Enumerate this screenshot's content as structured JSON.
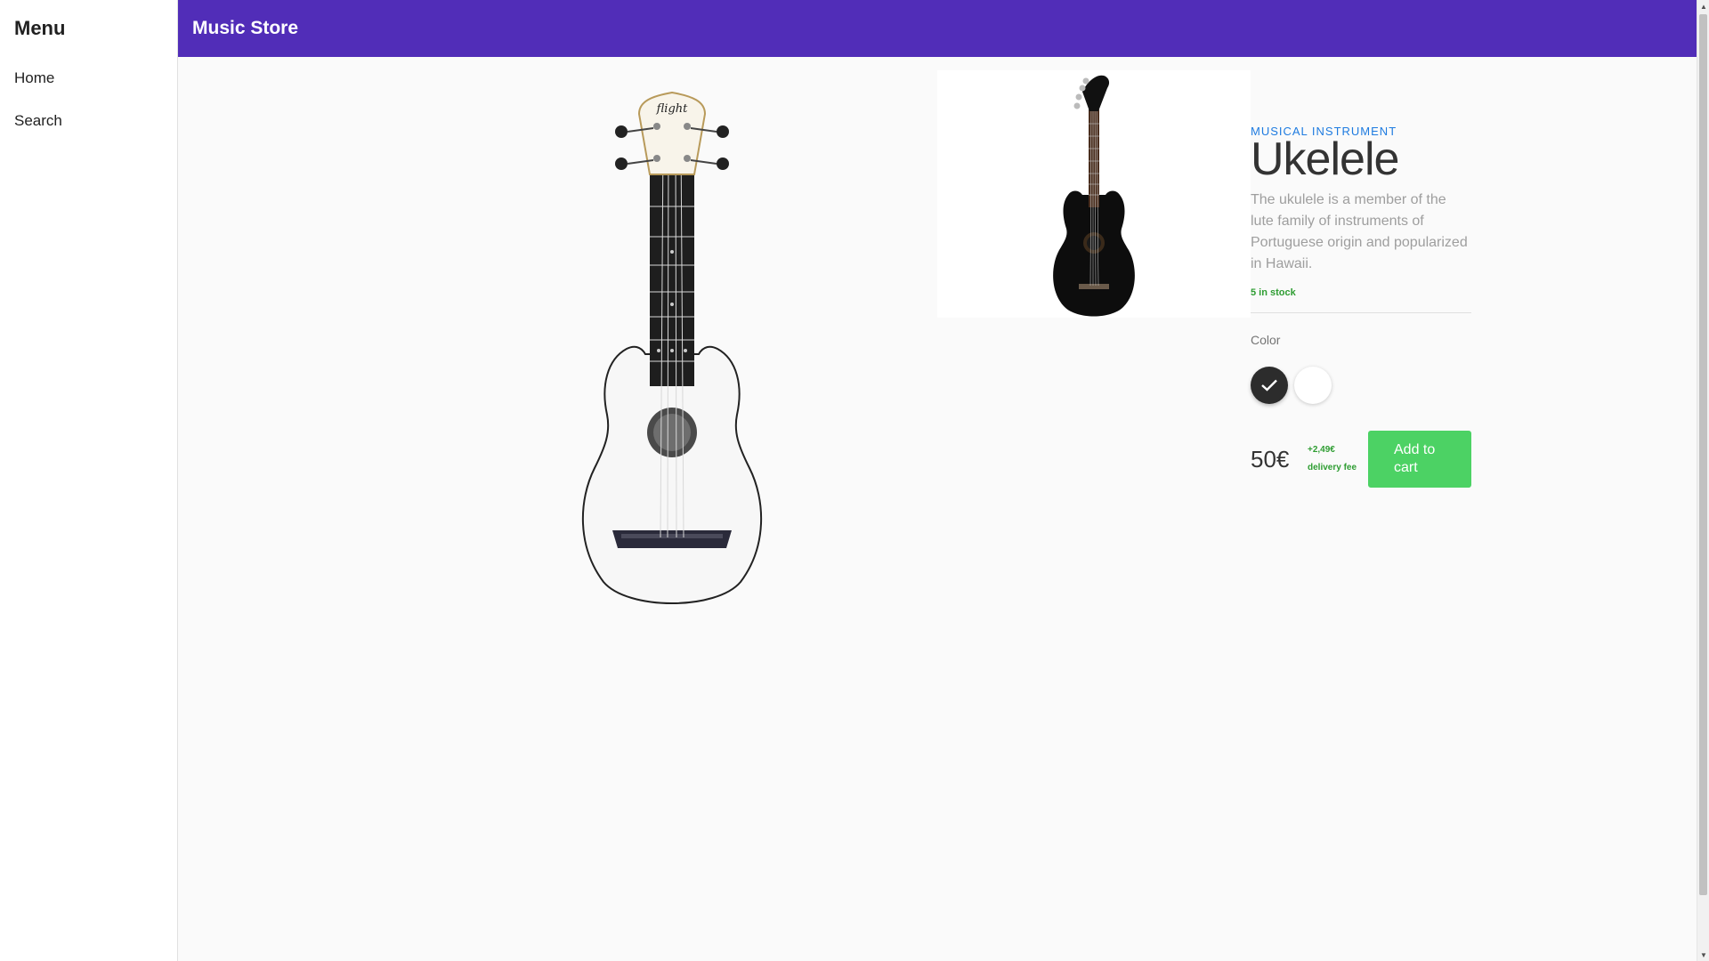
{
  "sidebar": {
    "title": "Menu",
    "items": [
      {
        "label": "Home"
      },
      {
        "label": "Search"
      }
    ]
  },
  "header": {
    "title": "Music Store"
  },
  "product": {
    "category": "MUSICAL INSTRUMENT",
    "name": "Ukelele",
    "description": "The ukulele is a member of the lute family of instruments of Portuguese origin and popularized in Hawaii.",
    "stock": "5 in stock",
    "color_label": "Color",
    "colors": [
      {
        "name": "black",
        "hex": "#2c2c2c",
        "selected": true
      },
      {
        "name": "white",
        "hex": "#ffffff",
        "selected": false
      }
    ],
    "price": "50€",
    "delivery_fee": "+2,49€",
    "delivery_fee_label": "delivery fee",
    "add_to_cart_label": "Add to cart",
    "main_image": "white-ukulele-image",
    "thumbnail_image": "black-ukulele-image"
  },
  "colors": {
    "header": "#512db8",
    "accent": "#1e7be0",
    "button": "#4cd264",
    "stock": "#2e9d32"
  }
}
